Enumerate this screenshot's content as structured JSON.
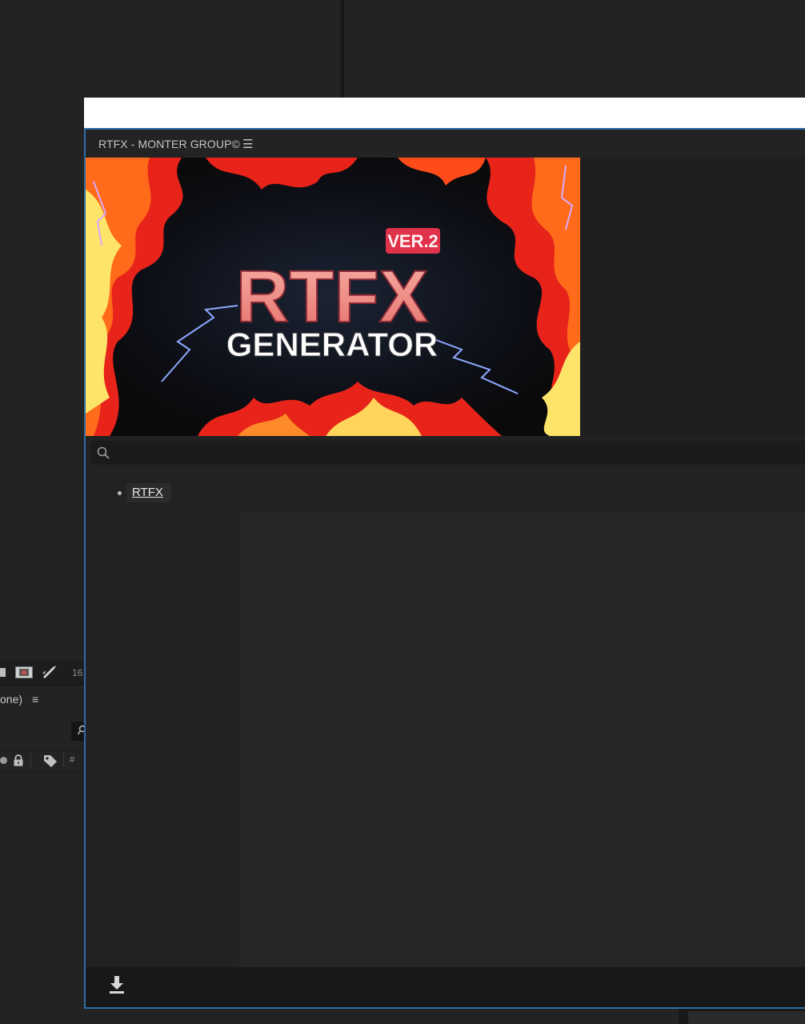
{
  "panel": {
    "title": "RTFX - MONTER GROUP©",
    "menu_icon": "hamburger-menu-icon"
  },
  "banner": {
    "badge": "VER.2",
    "headline": "RTFX",
    "subheadline": "GENERATOR",
    "colors": {
      "fire_red": "#e8231a",
      "fire_yellow": "#ffe46a",
      "lightning": "#8fa8ff",
      "title_pink": "#f0928c"
    }
  },
  "search": {
    "placeholder": "",
    "icon": "search-icon"
  },
  "nav": {
    "items": [
      {
        "label": "RTFX"
      }
    ]
  },
  "footer": {
    "download_icon": "download-icon"
  },
  "background_app": {
    "timeline_number": "16",
    "composition_label": "one)",
    "column_hash": "#"
  },
  "colors": {
    "accent_border": "#2d6ea8",
    "panel_bg": "#222222",
    "footer_bg": "#181818"
  }
}
